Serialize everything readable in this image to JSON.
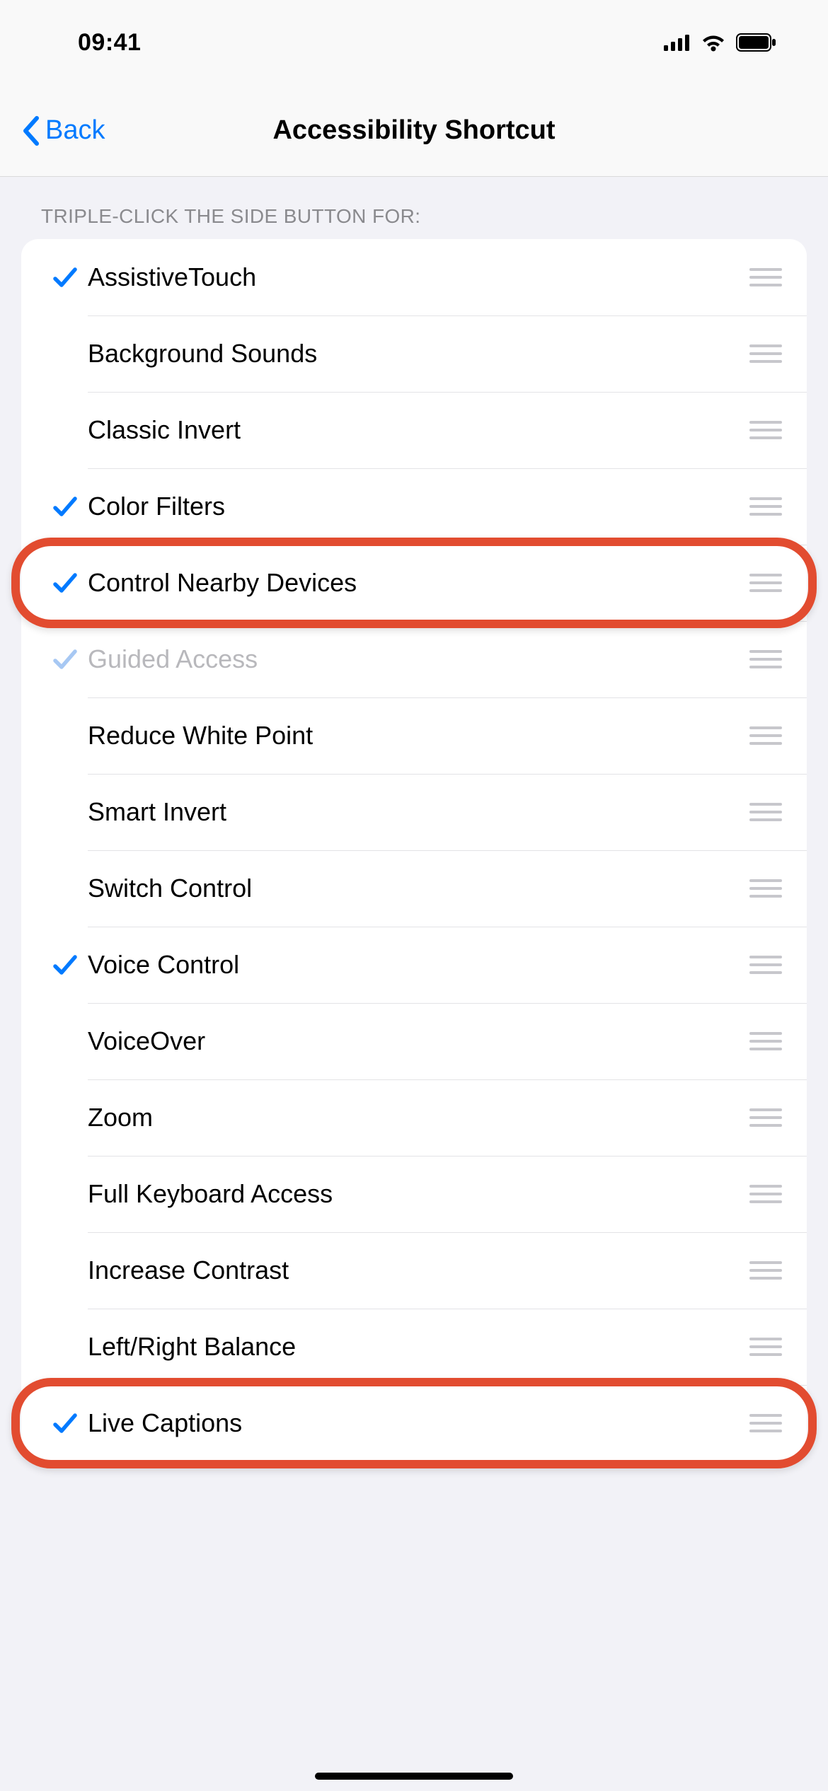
{
  "status": {
    "time": "09:41"
  },
  "nav": {
    "back_label": "Back",
    "title": "Accessibility Shortcut"
  },
  "section": {
    "header": "TRIPLE-CLICK THE SIDE BUTTON FOR:"
  },
  "colors": {
    "accent": "#007aff",
    "check_muted": "#a7c8f3",
    "highlight": "#e24c30"
  },
  "items": [
    {
      "label": "AssistiveTouch",
      "checked": true,
      "muted": false
    },
    {
      "label": "Background Sounds",
      "checked": false,
      "muted": false
    },
    {
      "label": "Classic Invert",
      "checked": false,
      "muted": false
    },
    {
      "label": "Color Filters",
      "checked": true,
      "muted": false
    },
    {
      "label": "Control Nearby Devices",
      "checked": true,
      "muted": false,
      "highlighted": true
    },
    {
      "label": "Guided Access",
      "checked": true,
      "muted": true
    },
    {
      "label": "Reduce White Point",
      "checked": false,
      "muted": false
    },
    {
      "label": "Smart Invert",
      "checked": false,
      "muted": false
    },
    {
      "label": "Switch Control",
      "checked": false,
      "muted": false
    },
    {
      "label": "Voice Control",
      "checked": true,
      "muted": false
    },
    {
      "label": "VoiceOver",
      "checked": false,
      "muted": false
    },
    {
      "label": "Zoom",
      "checked": false,
      "muted": false
    },
    {
      "label": "Full Keyboard Access",
      "checked": false,
      "muted": false
    },
    {
      "label": "Increase Contrast",
      "checked": false,
      "muted": false
    },
    {
      "label": "Left/Right Balance",
      "checked": false,
      "muted": false
    },
    {
      "label": "Live Captions",
      "checked": true,
      "muted": false,
      "highlighted": true
    }
  ]
}
